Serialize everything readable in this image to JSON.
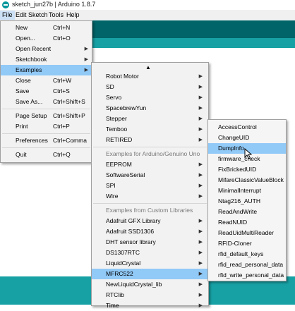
{
  "window": {
    "title": "sketch_jun27b | Arduino 1.8.7"
  },
  "menubar": [
    {
      "label": "File",
      "active": true
    },
    {
      "label": "Edit"
    },
    {
      "label": "Sketch"
    },
    {
      "label": "Tools"
    },
    {
      "label": "Help"
    }
  ],
  "file_menu": {
    "items": [
      {
        "label": "New",
        "shortcut": "Ctrl+N"
      },
      {
        "label": "Open...",
        "shortcut": "Ctrl+O"
      },
      {
        "label": "Open Recent",
        "submenu": true
      },
      {
        "label": "Sketchbook",
        "submenu": true
      },
      {
        "label": "Examples",
        "submenu": true,
        "highlighted": true
      },
      {
        "label": "Close",
        "shortcut": "Ctrl+W"
      },
      {
        "label": "Save",
        "shortcut": "Ctrl+S"
      },
      {
        "label": "Save As...",
        "shortcut": "Ctrl+Shift+S"
      },
      {
        "label": "Page Setup",
        "shortcut": "Ctrl+Shift+P"
      },
      {
        "label": "Print",
        "shortcut": "Ctrl+P"
      },
      {
        "label": "Preferences",
        "shortcut": "Ctrl+Comma"
      },
      {
        "label": "Quit",
        "shortcut": "Ctrl+Q"
      }
    ]
  },
  "examples_menu": {
    "scroll_up_glyph": "▲",
    "items": [
      {
        "label": "Robot Motor",
        "submenu": true
      },
      {
        "label": "SD",
        "submenu": true
      },
      {
        "label": "Servo",
        "submenu": true
      },
      {
        "label": "SpacebrewYun",
        "submenu": true
      },
      {
        "label": "Stepper",
        "submenu": true
      },
      {
        "label": "Temboo",
        "submenu": true
      },
      {
        "label": "RETIRED",
        "submenu": true
      },
      {
        "label": "Examples for Arduino/Genuino Uno",
        "header": true
      },
      {
        "label": "EEPROM",
        "submenu": true
      },
      {
        "label": "SoftwareSerial",
        "submenu": true
      },
      {
        "label": "SPI",
        "submenu": true
      },
      {
        "label": "Wire",
        "submenu": true
      },
      {
        "label": "Examples from Custom Libraries",
        "header": true
      },
      {
        "label": "Adafruit GFX Library",
        "submenu": true
      },
      {
        "label": "Adafruit SSD1306",
        "submenu": true
      },
      {
        "label": "DHT sensor library",
        "submenu": true
      },
      {
        "label": "DS1307RTC",
        "submenu": true
      },
      {
        "label": "LiquidCrystal",
        "submenu": true
      },
      {
        "label": "MFRC522",
        "submenu": true,
        "highlighted": true
      },
      {
        "label": "NewLiquidCrystal_lib",
        "submenu": true
      },
      {
        "label": "RTClib",
        "submenu": true
      },
      {
        "label": "Time",
        "submenu": true
      }
    ]
  },
  "mfrc522_menu": {
    "items": [
      {
        "label": "AccessControl"
      },
      {
        "label": "ChangeUID"
      },
      {
        "label": "DumpInfo",
        "highlighted": true
      },
      {
        "label": "firmware_check"
      },
      {
        "label": "FixBrickedUID"
      },
      {
        "label": "MifareClassicValueBlock"
      },
      {
        "label": "MinimalInterrupt"
      },
      {
        "label": "Ntag216_AUTH"
      },
      {
        "label": "ReadAndWrite"
      },
      {
        "label": "ReadNUID"
      },
      {
        "label": "ReadUidMultiReader"
      },
      {
        "label": "RFID-Cloner"
      },
      {
        "label": "rfid_default_keys"
      },
      {
        "label": "rfid_read_personal_data"
      },
      {
        "label": "rfid_write_personal_data"
      }
    ]
  },
  "colors": {
    "menu_highlight": "#91c9f7",
    "teal_dark": "#006468",
    "teal_light": "#17a1a5"
  }
}
